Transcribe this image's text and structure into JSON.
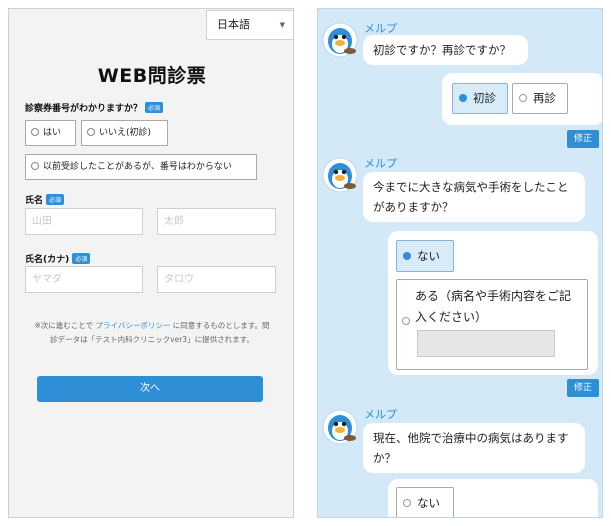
{
  "form": {
    "language": "日本語",
    "title": "WEB問診票",
    "q_card_number": "診察券番号がわかりますか？",
    "required": "必須",
    "opt_yes": "はい",
    "opt_no": "いいえ(初診)",
    "opt_visited": "以前受診したことがあるが、番号はわからない",
    "name_label": "氏名",
    "last_name_placeholder": "山田",
    "first_name_placeholder": "太郎",
    "kana_label": "氏名(カナ)",
    "last_kana_placeholder": "ヤマダ",
    "first_kana_placeholder": "タロウ",
    "note_prefix": "※次に進むことで ",
    "privacy_link": "プライバシーポリシー",
    "note_suffix": " に同意するものとします。問診データは「テスト内科クリニックver3」に提供されます。",
    "next_button": "次へ"
  },
  "chat": {
    "bot_name": "メルプ",
    "q1": "初診ですか？再診ですか？",
    "q1_opt_first": "初診",
    "q1_opt_return": "再診",
    "edit_label": "修正",
    "q2": "今までに大きな病気や手術をしたことがありますか？",
    "q2_opt_none": "ない",
    "q2_opt_yes": "ある（病名や手術内容をご記入ください）",
    "q3": "現在、他院で治療中の病気はありますか？",
    "q3_opt_none": "ない"
  },
  "colors": {
    "accent": "#2e8fd6",
    "chat_bg": "#d3e9f8",
    "selected_bg": "#d7ebf9"
  }
}
